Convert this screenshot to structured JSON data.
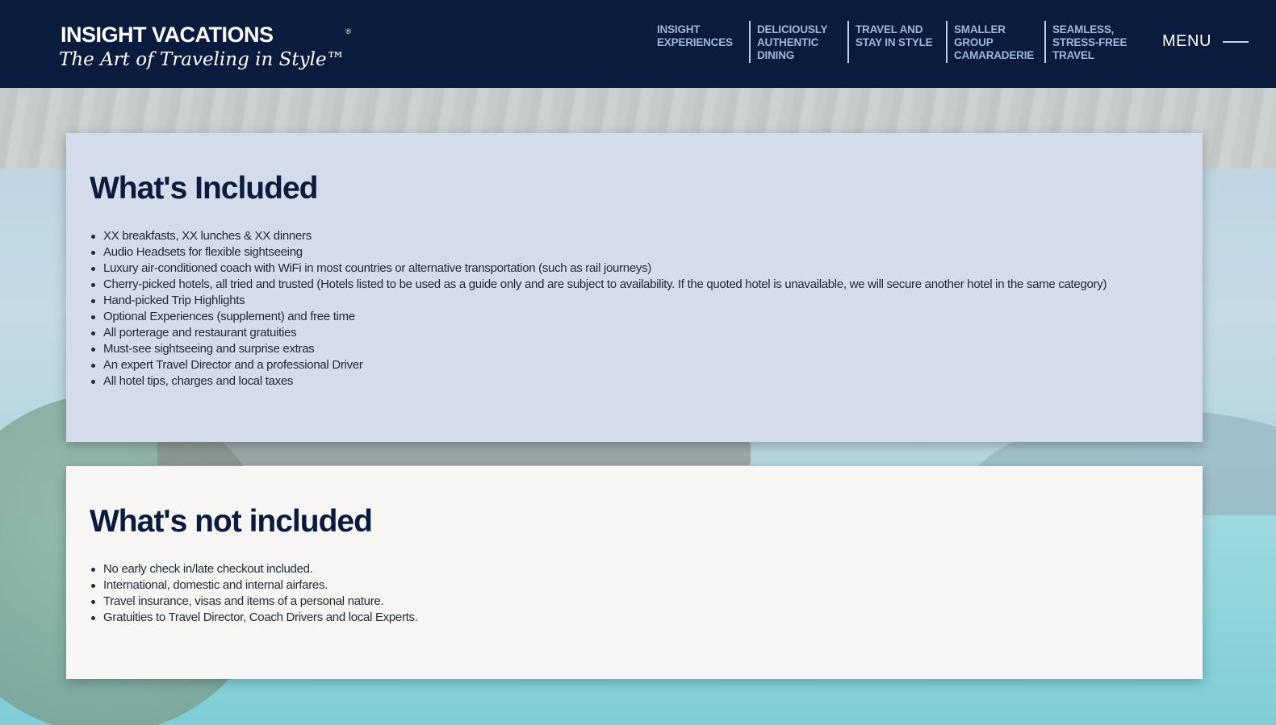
{
  "header": {
    "logo_main": "INSIGHT VACATIONS",
    "logo_reg": "®",
    "logo_tagline": "The Art of Traveling in Style™",
    "nav": [
      {
        "label": "INSIGHT EXPERIENCES"
      },
      {
        "label": "DELICIOUSLY AUTHENTIC DINING"
      },
      {
        "label": "TRAVEL AND STAY IN STYLE"
      },
      {
        "label": "SMALLER GROUP CAMARADERIE"
      },
      {
        "label": "SEAMLESS, STRESS-FREE TRAVEL"
      }
    ],
    "menu_label": "MENU"
  },
  "included": {
    "title": "What's Included",
    "items": [
      "XX breakfasts, XX lunches & XX dinners",
      "Audio Headsets for flexible sightseeing",
      "Luxury air-conditioned coach with WiFi in most countries or alternative transportation (such as rail journeys)",
      "Cherry-picked hotels, all tried and trusted (Hotels listed to be used as a guide only and are subject to availability. If the quoted hotel is unavailable, we will secure another hotel in the same category)",
      "Hand-picked Trip Highlights",
      "Optional Experiences (supplement) and free time",
      "All porterage and restaurant gratuities",
      "Must-see sightseeing and surprise extras",
      "An expert Travel Director and a professional Driver",
      "All hotel tips, charges and local taxes"
    ]
  },
  "not_included": {
    "title": "What's not included",
    "items": [
      "No early check in/late checkout included.",
      "International, domestic and internal airfares.",
      "Travel insurance, visas and items of a personal nature.",
      "Gratuities to Travel Director, Coach Drivers and local Experts."
    ]
  },
  "colors": {
    "header_bg": "#0b1b3d",
    "nav_text": "#9fb5d9",
    "included_bg": "#d4dbea",
    "not_included_bg": "#f8f6f4",
    "heading_text": "#0b1b3d"
  }
}
